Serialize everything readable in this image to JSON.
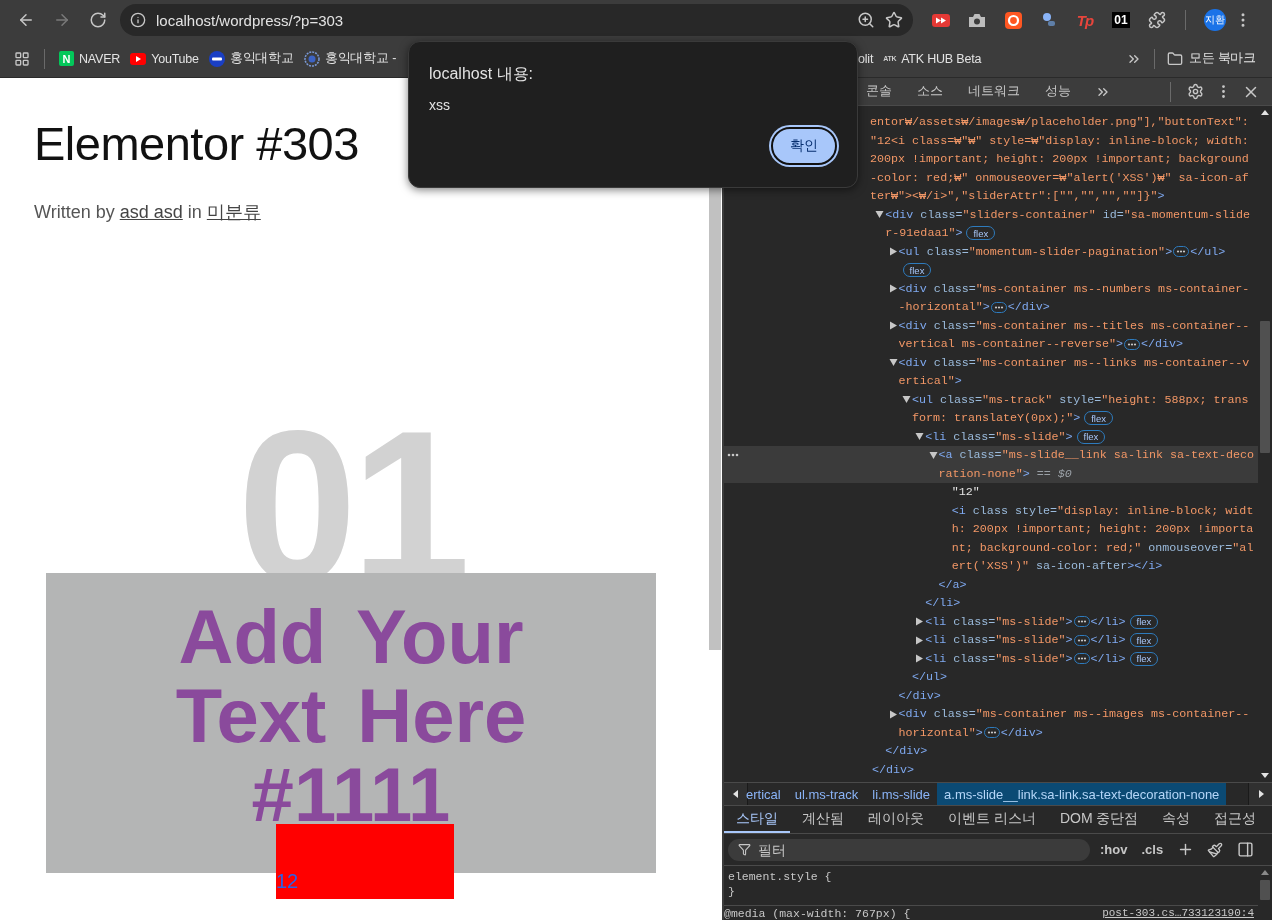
{
  "browser": {
    "nav": [
      {
        "kind": "back",
        "disabled": false
      },
      {
        "kind": "forward",
        "disabled": true
      },
      {
        "kind": "reload",
        "disabled": false
      }
    ],
    "url": "localhost/wordpress/?p=303",
    "extensions": [
      {
        "kind": "play"
      },
      {
        "kind": "camera"
      },
      {
        "kind": "ring"
      },
      {
        "kind": "figure"
      },
      {
        "kind": "mark",
        "label": "Tp"
      },
      {
        "kind": "tile",
        "label": "01"
      },
      {
        "kind": "puzzle"
      }
    ],
    "profile": {
      "initials": "지환"
    }
  },
  "bookmarks": {
    "items": [
      {
        "kind": "naver",
        "icon_text": "N",
        "label": "NAVER"
      },
      {
        "kind": "youtube",
        "label": "YouTube"
      },
      {
        "kind": "hongik",
        "label": "홍익대학교"
      },
      {
        "kind": "emblem",
        "label": "홍익대학교 -"
      },
      {
        "kind": "plain",
        "label": "olit"
      },
      {
        "kind": "atk",
        "icon_text": "ATK",
        "label": "ATK HUB Beta"
      }
    ],
    "folder": "모든 북마크"
  },
  "page": {
    "title": "Elementor #303",
    "byline": {
      "prefix": "Written by",
      "author": "asd asd",
      "middle": "in",
      "category": "미분류"
    },
    "slider": {
      "number": "01",
      "heading": "Add Your Text Here #1111",
      "link_text": "12"
    }
  },
  "dialog": {
    "title": "localhost 내용:",
    "message": "xss",
    "button": "확인"
  },
  "devtools": {
    "tabs": [
      {
        "label": "콘솔",
        "selected": false
      },
      {
        "label": "소스",
        "selected": false
      },
      {
        "label": "네트워크",
        "selected": false
      },
      {
        "label": "성능",
        "selected": false
      }
    ],
    "code": {
      "selected": false,
      "lines": [
        {
          "parts": [
            {
              "kind": "value",
              "text": "entor₩/assets₩/images₩/placeholder.png\"],\"buttonText\":"
            }
          ]
        },
        {
          "parts": [
            {
              "kind": "value",
              "text": "\"12<i class=₩\"₩\" style=₩\"display: inline-block; width:"
            }
          ]
        },
        {
          "parts": [
            {
              "kind": "value",
              "text": "200px !important; height: 200px !important; background"
            }
          ]
        },
        {
          "parts": [
            {
              "kind": "value",
              "text": "-color: red;₩\" onmouseover=₩\"alert('XSS')₩\" sa-icon-af"
            }
          ]
        },
        {
          "parts": [
            {
              "kind": "value",
              "text": "ter₩\"><₩/i>\",\"sliderAttr\":[\"\",\"\",\"\",\"\"]}\""
            },
            {
              "kind": "tag",
              "text": ">"
            }
          ]
        }
      ],
      "children": [
        {
          "expanded": true,
          "selected": false,
          "lines": [
            {
              "parts": [
                {
                  "kind": "tag",
                  "text": "<div"
                },
                {
                  "kind": "attr",
                  "text": " class="
                },
                {
                  "kind": "value",
                  "text": "\"sliders-container\""
                },
                {
                  "kind": "attr",
                  "text": " id="
                },
                {
                  "kind": "value",
                  "text": "\"sa-momentum-slide"
                }
              ]
            },
            {
              "parts": [
                {
                  "kind": "value",
                  "text": "r-91edaa1\""
                },
                {
                  "kind": "tag",
                  "text": ">"
                },
                {
                  "kind": "badge",
                  "text": "flex"
                }
              ]
            }
          ],
          "children": [
            {
              "expanded": false,
              "selected": false,
              "lines": [
                {
                  "parts": [
                    {
                      "kind": "tag",
                      "text": "<ul"
                    },
                    {
                      "kind": "attr",
                      "text": " class="
                    },
                    {
                      "kind": "value",
                      "text": "\"momentum-slider-pagination\""
                    },
                    {
                      "kind": "tag",
                      "text": ">"
                    },
                    {
                      "kind": "more"
                    },
                    {
                      "kind": "tag",
                      "text": "</ul>"
                    }
                  ]
                },
                {
                  "parts": [
                    {
                      "kind": "badge",
                      "text": "flex"
                    }
                  ]
                }
              ]
            },
            {
              "expanded": false,
              "selected": false,
              "lines": [
                {
                  "parts": [
                    {
                      "kind": "tag",
                      "text": "<div"
                    },
                    {
                      "kind": "attr",
                      "text": " class="
                    },
                    {
                      "kind": "value",
                      "text": "\"ms-container ms--numbers ms-container-"
                    }
                  ]
                },
                {
                  "parts": [
                    {
                      "kind": "value",
                      "text": "-horizontal\""
                    },
                    {
                      "kind": "tag",
                      "text": ">"
                    },
                    {
                      "kind": "more"
                    },
                    {
                      "kind": "tag",
                      "text": "</div>"
                    }
                  ]
                }
              ]
            },
            {
              "expanded": false,
              "selected": false,
              "lines": [
                {
                  "parts": [
                    {
                      "kind": "tag",
                      "text": "<div"
                    },
                    {
                      "kind": "attr",
                      "text": " class="
                    },
                    {
                      "kind": "value",
                      "text": "\"ms-container ms--titles ms-container--"
                    }
                  ]
                },
                {
                  "parts": [
                    {
                      "kind": "value",
                      "text": "vertical ms-container--reverse\""
                    },
                    {
                      "kind": "tag",
                      "text": ">"
                    },
                    {
                      "kind": "more"
                    },
                    {
                      "kind": "tag",
                      "text": "</div>"
                    }
                  ]
                }
              ]
            },
            {
              "expanded": true,
              "selected": false,
              "lines": [
                {
                  "parts": [
                    {
                      "kind": "tag",
                      "text": "<div"
                    },
                    {
                      "kind": "attr",
                      "text": " class="
                    },
                    {
                      "kind": "value",
                      "text": "\"ms-container ms--links ms-container--v"
                    }
                  ]
                },
                {
                  "parts": [
                    {
                      "kind": "value",
                      "text": "ertical\""
                    },
                    {
                      "kind": "tag",
                      "text": ">"
                    }
                  ]
                }
              ],
              "children": [
                {
                  "expanded": true,
                  "selected": false,
                  "lines": [
                    {
                      "parts": [
                        {
                          "kind": "tag",
                          "text": "<ul"
                        },
                        {
                          "kind": "attr",
                          "text": " class="
                        },
                        {
                          "kind": "value",
                          "text": "\"ms-track\""
                        },
                        {
                          "kind": "attr",
                          "text": " style="
                        },
                        {
                          "kind": "value",
                          "text": "\"height: 588px; trans"
                        }
                      ]
                    },
                    {
                      "parts": [
                        {
                          "kind": "value",
                          "text": "form: translateY(0px);\""
                        },
                        {
                          "kind": "tag",
                          "text": ">"
                        },
                        {
                          "kind": "badge",
                          "text": "flex"
                        }
                      ]
                    }
                  ],
                  "children": [
                    {
                      "expanded": true,
                      "selected": false,
                      "lines": [
                        {
                          "parts": [
                            {
                              "kind": "tag",
                              "text": "<li"
                            },
                            {
                              "kind": "attr",
                              "text": " class="
                            },
                            {
                              "kind": "value",
                              "text": "\"ms-slide\""
                            },
                            {
                              "kind": "tag",
                              "text": ">"
                            },
                            {
                              "kind": "badge",
                              "text": "flex"
                            }
                          ]
                        }
                      ],
                      "children": [
                        {
                          "expanded": true,
                          "selected": true,
                          "lines": [
                            {
                              "parts": [
                                {
                                  "kind": "tag",
                                  "text": "<a"
                                },
                                {
                                  "kind": "attr",
                                  "text": " class="
                                },
                                {
                                  "kind": "value",
                                  "text": "\"ms-slide__link sa-link sa-text-deco"
                                }
                              ]
                            },
                            {
                              "parts": [
                                {
                                  "kind": "value",
                                  "text": "ration-none\""
                                },
                                {
                                  "kind": "tag",
                                  "text": ">"
                                },
                                {
                                  "kind": "note",
                                  "text": " == $0"
                                }
                              ]
                            }
                          ],
                          "children": [
                            {
                              "selected": false,
                              "lines": [
                                {
                                  "parts": [
                                    {
                                      "kind": "text",
                                      "text": "\"12\""
                                    }
                                  ]
                                }
                              ]
                            },
                            {
                              "selected": false,
                              "lines": [
                                {
                                  "parts": [
                                    {
                                      "kind": "tag",
                                      "text": "<i"
                                    },
                                    {
                                      "kind": "attr",
                                      "text": " class style="
                                    },
                                    {
                                      "kind": "value",
                                      "text": "\"display: inline-block; widt"
                                    }
                                  ]
                                },
                                {
                                  "parts": [
                                    {
                                      "kind": "value",
                                      "text": "h: 200px !important; height: 200px !importa"
                                    }
                                  ]
                                },
                                {
                                  "parts": [
                                    {
                                      "kind": "value",
                                      "text": "nt; background-color: red;\""
                                    },
                                    {
                                      "kind": "attr",
                                      "text": " onmouseover="
                                    },
                                    {
                                      "kind": "value",
                                      "text": "\"al"
                                    }
                                  ]
                                },
                                {
                                  "parts": [
                                    {
                                      "kind": "value",
                                      "text": "ert('XSS')\""
                                    },
                                    {
                                      "kind": "attr",
                                      "text": " sa-icon-after"
                                    },
                                    {
                                      "kind": "tag",
                                      "text": "></i>"
                                    }
                                  ]
                                }
                              ]
                            }
                          ],
                          "close": {
                            "parts": [
                              {
                                "kind": "tag",
                                "text": "</a>"
                              }
                            ]
                          }
                        }
                      ],
                      "close": {
                        "parts": [
                          {
                            "kind": "tag",
                            "text": "</li>"
                          }
                        ]
                      }
                    },
                    {
                      "expanded": false,
                      "selected": false,
                      "lines": [
                        {
                          "parts": [
                            {
                              "kind": "tag",
                              "text": "<li"
                            },
                            {
                              "kind": "attr",
                              "text": " class="
                            },
                            {
                              "kind": "value",
                              "text": "\"ms-slide\""
                            },
                            {
                              "kind": "tag",
                              "text": ">"
                            },
                            {
                              "kind": "more"
                            },
                            {
                              "kind": "tag",
                              "text": "</li>"
                            },
                            {
                              "kind": "badge",
                              "text": "flex"
                            }
                          ]
                        }
                      ]
                    },
                    {
                      "expanded": false,
                      "selected": false,
                      "lines": [
                        {
                          "parts": [
                            {
                              "kind": "tag",
                              "text": "<li"
                            },
                            {
                              "kind": "attr",
                              "text": " class="
                            },
                            {
                              "kind": "value",
                              "text": "\"ms-slide\""
                            },
                            {
                              "kind": "tag",
                              "text": ">"
                            },
                            {
                              "kind": "more"
                            },
                            {
                              "kind": "tag",
                              "text": "</li>"
                            },
                            {
                              "kind": "badge",
                              "text": "flex"
                            }
                          ]
                        }
                      ]
                    },
                    {
                      "expanded": false,
                      "selected": false,
                      "lines": [
                        {
                          "parts": [
                            {
                              "kind": "tag",
                              "text": "<li"
                            },
                            {
                              "kind": "attr",
                              "text": " class="
                            },
                            {
                              "kind": "value",
                              "text": "\"ms-slide\""
                            },
                            {
                              "kind": "tag",
                              "text": ">"
                            },
                            {
                              "kind": "more"
                            },
                            {
                              "kind": "tag",
                              "text": "</li>"
                            },
                            {
                              "kind": "badge",
                              "text": "flex"
                            }
                          ]
                        }
                      ]
                    }
                  ],
                  "close": {
                    "parts": [
                      {
                        "kind": "tag",
                        "text": "</ul>"
                      }
                    ]
                  }
                }
              ],
              "close": {
                "parts": [
                  {
                    "kind": "tag",
                    "text": "</div>"
                  }
                ]
              }
            },
            {
              "expanded": false,
              "selected": false,
              "lines": [
                {
                  "parts": [
                    {
                      "kind": "tag",
                      "text": "<div"
                    },
                    {
                      "kind": "attr",
                      "text": " class="
                    },
                    {
                      "kind": "value",
                      "text": "\"ms-container ms--images ms-container--"
                    }
                  ]
                },
                {
                  "parts": [
                    {
                      "kind": "value",
                      "text": "horizontal\""
                    },
                    {
                      "kind": "tag",
                      "text": ">"
                    },
                    {
                      "kind": "more"
                    },
                    {
                      "kind": "tag",
                      "text": "</div>"
                    }
                  ]
                }
              ]
            }
          ],
          "close": {
            "parts": [
              {
                "kind": "tag",
                "text": "</div>"
              }
            ]
          }
        }
      ],
      "close": {
        "parts": [
          {
            "kind": "tag",
            "text": "</div>"
          }
        ]
      }
    },
    "breadcrumbs": [
      {
        "label": "ertical",
        "selected": false
      },
      {
        "label": "ul.ms-track",
        "selected": false
      },
      {
        "label": "li.ms-slide",
        "selected": false
      },
      {
        "label": "a.ms-slide__link.sa-link.sa-text-decoration-none",
        "selected": true
      }
    ],
    "panel_tabs": [
      {
        "label": "스타일",
        "selected": true
      },
      {
        "label": "계산됨",
        "selected": false
      },
      {
        "label": "레이아웃",
        "selected": false
      },
      {
        "label": "이벤트 리스너",
        "selected": false
      },
      {
        "label": "DOM 중단점",
        "selected": false
      },
      {
        "label": "속성",
        "selected": false
      },
      {
        "label": "접근성",
        "selected": false
      }
    ],
    "filter": {
      "placeholder": "필터",
      "buttons": [
        ":hov",
        ".cls"
      ]
    },
    "rules": [
      {
        "selector": "element.style {",
        "close": "}"
      }
    ],
    "media": {
      "query": "@media (max-width: 767px) {",
      "source": "post-303.cs…733123190:4"
    }
  }
}
